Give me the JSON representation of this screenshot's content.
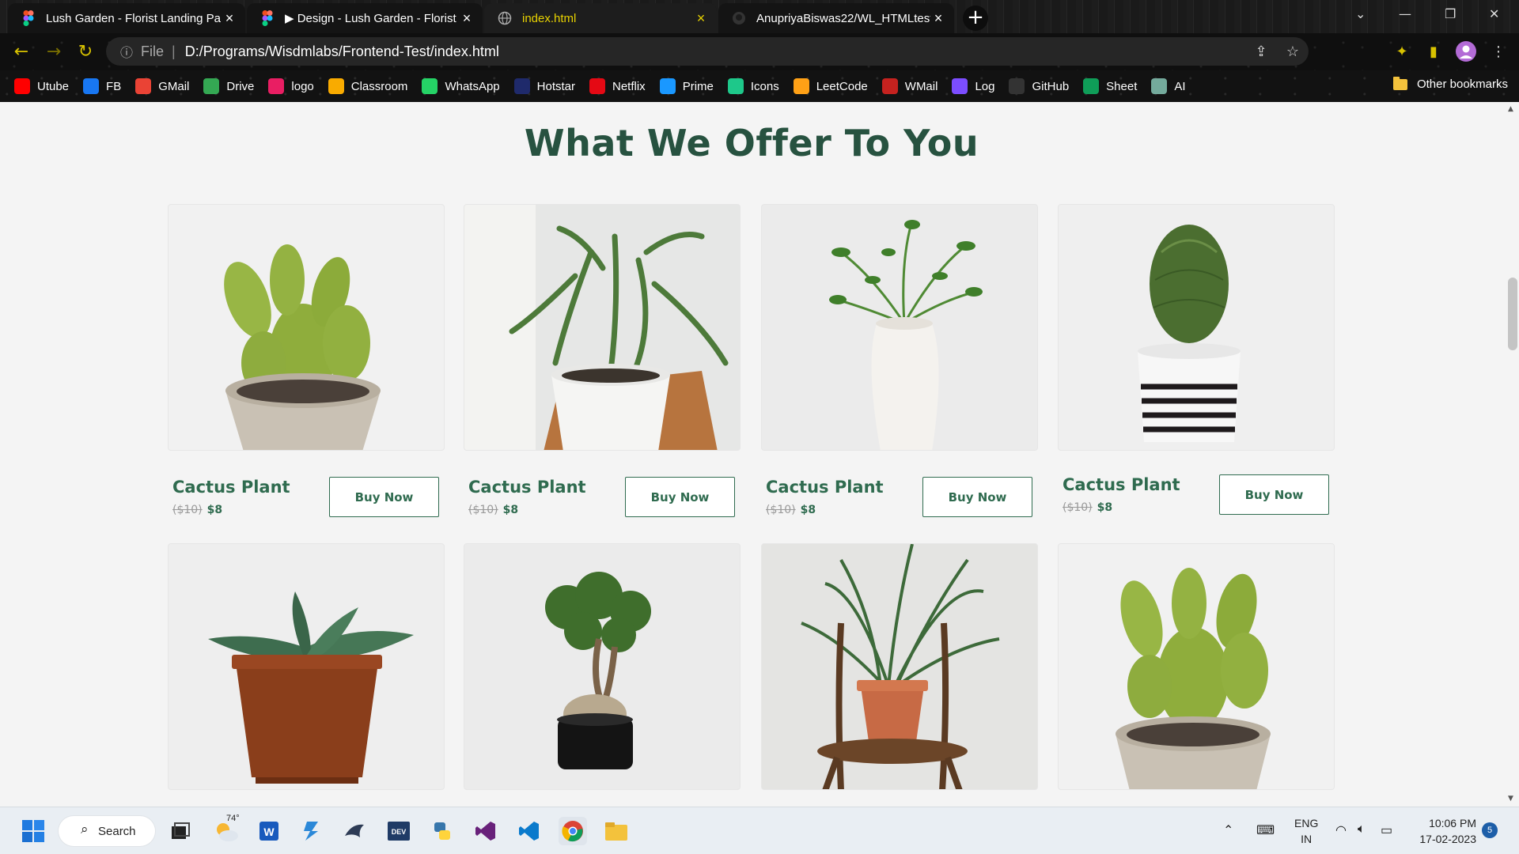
{
  "browser": {
    "tabs": [
      {
        "title": "Lush Garden - Florist Landing Pa",
        "icon": "figma-icon",
        "active": false
      },
      {
        "title": "▶ Design - Lush Garden - Florist",
        "icon": "figma-icon",
        "active": false
      },
      {
        "title": "index.html",
        "icon": "globe-icon",
        "active": true
      },
      {
        "title": "AnupriyaBiswas22/WL_HTMLtest",
        "icon": "github-icon",
        "active": false
      }
    ],
    "address": {
      "scheme": "File",
      "separator": "|",
      "url": "D:/Programs/Wisdmlabs/Frontend-Test/index.html"
    },
    "bookmarks": [
      {
        "label": "Utube",
        "icon": "youtube-icon",
        "color": "#ff0000"
      },
      {
        "label": "FB",
        "icon": "facebook-icon",
        "color": "#1877f2"
      },
      {
        "label": "GMail",
        "icon": "gmail-icon",
        "color": "#ea4335"
      },
      {
        "label": "Drive",
        "icon": "drive-icon",
        "color": "#34a853"
      },
      {
        "label": "logo",
        "icon": "music-icon",
        "color": "#e91e63"
      },
      {
        "label": "Classroom",
        "icon": "classroom-icon",
        "color": "#f9ab00"
      },
      {
        "label": "WhatsApp",
        "icon": "whatsapp-icon",
        "color": "#25d366"
      },
      {
        "label": "Hotstar",
        "icon": "hotstar-icon",
        "color": "#1f2a6b"
      },
      {
        "label": "Netflix",
        "icon": "netflix-icon",
        "color": "#e50914"
      },
      {
        "label": "Prime",
        "icon": "prime-icon",
        "color": "#1a98ff"
      },
      {
        "label": "Icons",
        "icon": "vuetify-icon",
        "color": "#1ec88a"
      },
      {
        "label": "LeetCode",
        "icon": "leetcode-icon",
        "color": "#ffa116"
      },
      {
        "label": "WMail",
        "icon": "gmail-icon",
        "color": "#c5221f"
      },
      {
        "label": "Log",
        "icon": "arc-icon",
        "color": "#7c4dff"
      },
      {
        "label": "GitHub",
        "icon": "github-icon",
        "color": "#333333"
      },
      {
        "label": "Sheet",
        "icon": "sheets-icon",
        "color": "#0f9d58"
      },
      {
        "label": "AI",
        "icon": "openai-icon",
        "color": "#74aa9c"
      }
    ],
    "other_bookmarks": "Other bookmarks"
  },
  "page": {
    "section_title": "What We Offer To You",
    "products": [
      {
        "name": "Cactus Plant",
        "old_price": "($10)",
        "price": "$8",
        "button": "Buy Now",
        "image": "bunny-ear-cactus"
      },
      {
        "name": "Cactus Plant",
        "old_price": "($10)",
        "price": "$8",
        "button": "Buy Now",
        "image": "palm-in-white-pot"
      },
      {
        "name": "Cactus Plant",
        "old_price": "($10)",
        "price": "$8",
        "button": "Buy Now",
        "image": "sprigs-in-white-vase"
      },
      {
        "name": "Cactus Plant",
        "old_price": "($10)",
        "price": "$8",
        "button": "Buy Now",
        "image": "columnar-cactus-striped-pot"
      },
      {
        "image": "succulent-terracotta-pot"
      },
      {
        "image": "bonsai-black-pot"
      },
      {
        "image": "palm-on-wooden-chair"
      },
      {
        "image": "bunny-ear-cactus"
      }
    ]
  },
  "taskbar": {
    "search_label": "Search",
    "weather": "74°",
    "lang_top": "ENG",
    "lang_bottom": "IN",
    "time": "10:06 PM",
    "date": "17-02-2023",
    "notifications": "5"
  },
  "colors": {
    "accent_green": "#2f6b4f",
    "title_green": "#275240",
    "active_tab_text": "#e8d200"
  }
}
